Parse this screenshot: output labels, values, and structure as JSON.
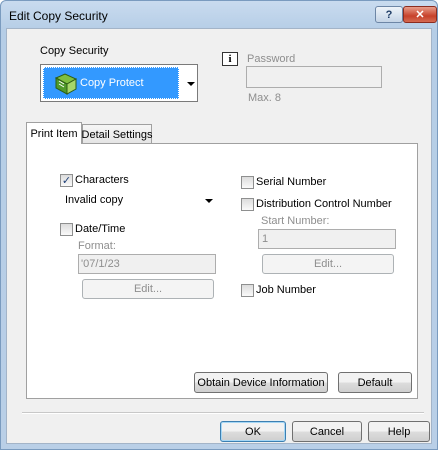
{
  "window": {
    "title": "Edit Copy Security",
    "help_label": "?",
    "close_label": "✕"
  },
  "copy_security": {
    "label": "Copy Security",
    "selected": "Copy Protect",
    "icon": "copy-protect-book-icon"
  },
  "password": {
    "info_glyph": "i",
    "label": "Password",
    "value": "",
    "max_label": "Max. 8"
  },
  "tabs": [
    {
      "label": "Print Item",
      "active": true
    },
    {
      "label": "Detail Settings",
      "active": false
    }
  ],
  "print_item": {
    "characters": {
      "label": "Characters",
      "checked": true,
      "check_glyph": "✓",
      "value": "Invalid copy"
    },
    "date_time": {
      "label": "Date/Time",
      "checked": false,
      "format_label": "Format:",
      "format_value": "'07/1/23",
      "edit_label": "Edit..."
    },
    "serial_number": {
      "label": "Serial Number",
      "checked": false
    },
    "distribution": {
      "label": "Distribution Control Number",
      "checked": false,
      "start_label": "Start Number:",
      "start_value": "1",
      "edit_label": "Edit..."
    },
    "job_number": {
      "label": "Job Number",
      "checked": false
    }
  },
  "panel_buttons": {
    "obtain": "Obtain Device Information",
    "default": "Default"
  },
  "dialog_buttons": {
    "ok": "OK",
    "cancel": "Cancel",
    "help": "Help"
  }
}
